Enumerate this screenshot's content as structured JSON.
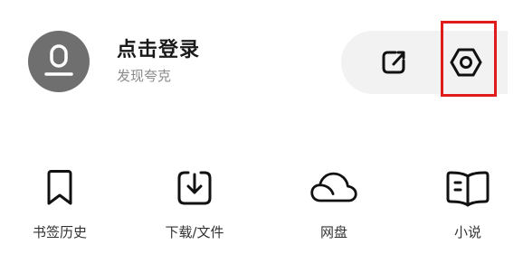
{
  "profile": {
    "title": "点击登录",
    "subtitle": "发现夸克"
  },
  "actions": {
    "share_icon": "share-icon",
    "settings_icon": "settings-hexagon-icon",
    "highlight_color": "#e01b1b"
  },
  "menu": {
    "items": [
      {
        "label": "书签历史",
        "icon": "bookmark-icon"
      },
      {
        "label": "下载/文件",
        "icon": "download-icon"
      },
      {
        "label": "网盘",
        "icon": "cloud-drive-icon"
      },
      {
        "label": "小说",
        "icon": "book-icon"
      }
    ]
  },
  "colors": {
    "avatar_bg": "#6f6f6f",
    "pill_bg": "#f2f2f2",
    "icon_stroke": "#111111"
  }
}
